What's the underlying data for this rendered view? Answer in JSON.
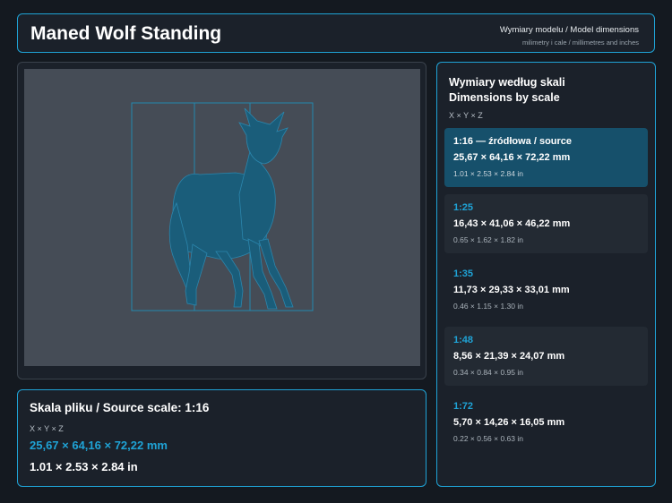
{
  "header": {
    "title": "Maned Wolf Standing",
    "subtitle": "Wymiary modelu / Model dimensions",
    "caption": "milimetry i cale / millimetres and inches"
  },
  "source": {
    "title": "Skala pliku / Source scale: 1:16",
    "axes": "X × Y × Z",
    "mm": "25,67 × 64,16 × 72,22 mm",
    "inches": "1.01 × 2.53 × 2.84 in"
  },
  "scales": {
    "title_pl": "Wymiary według skali",
    "title_en": "Dimensions by scale",
    "axes": "X × Y × Z",
    "items": [
      {
        "label": "1:16  —  źródłowa / source",
        "mm": "25,67 × 64,16 × 72,22 mm",
        "inches": "1.01 × 2.53 × 2.84 in",
        "state": "active"
      },
      {
        "label": "1:25",
        "mm": "16,43 × 41,06 × 46,22 mm",
        "inches": "0.65 × 1.62 × 1.82 in",
        "state": "shaded"
      },
      {
        "label": "1:35",
        "mm": "11,73 × 29,33 × 33,01 mm",
        "inches": "0.46 × 1.15 × 1.30 in",
        "state": "plain"
      },
      {
        "label": "1:48",
        "mm": "8,56 × 21,39 × 24,07 mm",
        "inches": "0.34 × 0.84 × 0.95 in",
        "state": "shaded"
      },
      {
        "label": "1:72",
        "mm": "5,70 × 14,26 × 16,05 mm",
        "inches": "0.22 × 0.56 × 0.63 in",
        "state": "plain"
      }
    ]
  },
  "colors": {
    "accent": "#1fa3d6",
    "background": "#141920",
    "panel": "#1b212a",
    "viewport": "#454c56",
    "active_card": "#16506b",
    "model": "#1a5d7a"
  },
  "viewer": {
    "model_icon": "wolf-model-icon"
  }
}
